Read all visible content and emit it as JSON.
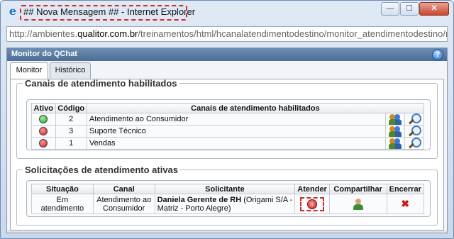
{
  "window": {
    "title": "## Nova Mensagem ## - Internet Explorer",
    "controls": {
      "minimize": "—",
      "maximize": "☐",
      "close": "✕"
    },
    "icon": "ie-icon"
  },
  "address": {
    "prefix": "http://ambientes.",
    "host": "qualitor.com.br",
    "path": "/treinamentos/html/hcanalatendimentodestino/monitor_atendimentodestino/mo"
  },
  "panel": {
    "title": "Monitor do QChat",
    "help_icon": "help-icon"
  },
  "tabs": [
    {
      "label": "Monitor",
      "active": true
    },
    {
      "label": "Histórico",
      "active": false
    }
  ],
  "channels": {
    "legend": "Canais de atendimento habilitados",
    "headers": {
      "active": "Ativo",
      "code": "Código",
      "name": "Canais de atendimento habilitados"
    },
    "rows": [
      {
        "status": "green",
        "code": "2",
        "name": "Atendimento ao Consumidor",
        "attendants_icon": "attendants-icon",
        "view_icon": "magnify-icon"
      },
      {
        "status": "red",
        "code": "3",
        "name": "Suporte Técnico",
        "attendants_icon": "attendants-icon",
        "view_icon": "magnify-icon"
      },
      {
        "status": "red",
        "code": "1",
        "name": "Vendas",
        "attendants_icon": "attendants-icon",
        "view_icon": "magnify-icon"
      }
    ]
  },
  "requests": {
    "legend": "Solicitações de atendimento ativas",
    "headers": {
      "situation": "Situação",
      "channel": "Canal",
      "requester": "Solicitante",
      "attend": "Atender",
      "share": "Compartilhar",
      "close": "Encerrar"
    },
    "rows": [
      {
        "situation": "Em atendimento",
        "channel_line1": "Atendimento ao",
        "channel_line2": "Consumidor",
        "requester_name": "Daniela Gerente de RH",
        "requester_org1": " (Origami S/A -",
        "requester_org2": "Matriz - Porto Alegre)",
        "close_glyph": "✖"
      }
    ]
  },
  "colors": {
    "status_green": "#22b022",
    "status_red": "#d01818",
    "highlight": "#d42a2a",
    "header_blue": "#5778a3"
  }
}
